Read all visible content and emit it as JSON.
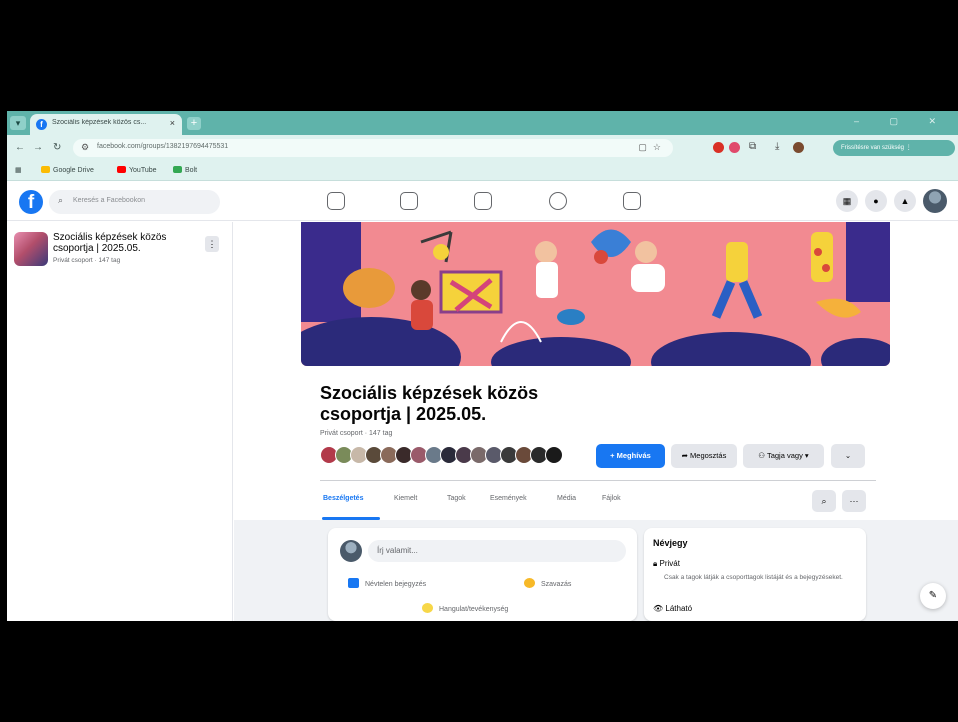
{
  "browser": {
    "tab_title": "Szociális képzések közös cs...",
    "tab_close": "×",
    "new_tab": "+",
    "url": "facebook.com/groups/1382197694475531",
    "bookmarks": [
      "Google Drive",
      "YouTube",
      "Bolt"
    ],
    "profile_pill": "Frissítésre van szükség ⋮",
    "window_controls": "– ▢ ✕"
  },
  "fb": {
    "logo": "f",
    "search_placeholder": "Keresés a Facebookon",
    "nav_icons": [
      "home-icon",
      "video-icon",
      "marketplace-icon",
      "groups-icon",
      "gaming-icon"
    ]
  },
  "sidebar": {
    "group_name": "Szociális képzések közös csoportja | 2025.05.",
    "group_meta": "Privát csoport · 147 tag",
    "more_label": "⋮"
  },
  "group": {
    "title": "Szociális képzések közös csoportja | 2025.05.",
    "meta": "Privát csoport · 147 tag",
    "invite_button": "+ Meghívás",
    "share_button": "Megosztás",
    "member_button": "Tagja vagy ▾",
    "more_button": "⌄"
  },
  "tabs": {
    "items": [
      "Beszélgetés",
      "Kiemelt",
      "Tagok",
      "Események",
      "Média",
      "Fájlok"
    ],
    "active": "Beszélgetés",
    "search": "⌕",
    "more": "···"
  },
  "composer": {
    "placeholder": "Írj valamit...",
    "actions": [
      "Névtelen bejegyzés",
      "Szavazás",
      "Hangulat/tevékenység"
    ]
  },
  "about": {
    "title": "Névjegy",
    "privacy_label": "Privát",
    "privacy_desc": "Csak a tagok látják a csoporttagok listáját és a bejegyzéseket.",
    "visible_label": "Látható"
  },
  "colors": {
    "fb_blue": "#1877f2",
    "chrome_accent": "#5fb3aa",
    "cover_bg": "#f28a91"
  }
}
